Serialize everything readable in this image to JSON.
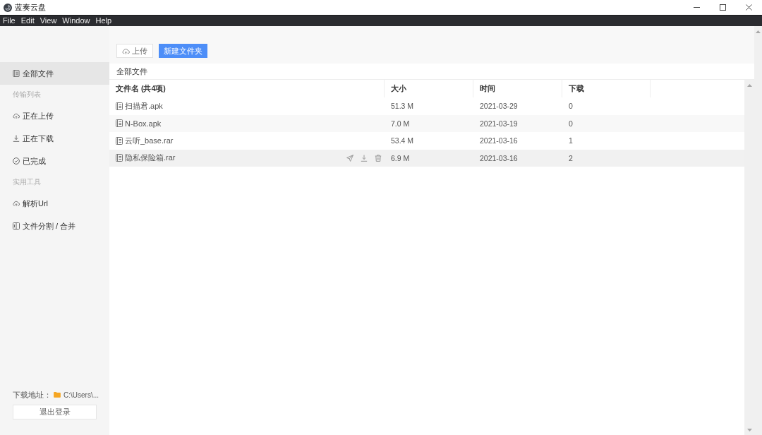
{
  "window": {
    "title": "蓝奏云盘"
  },
  "menu": [
    "File",
    "Edit",
    "View",
    "Window",
    "Help"
  ],
  "sidebar": {
    "groups": [
      {
        "items": [
          {
            "label": "全部文件",
            "selected": true
          }
        ]
      },
      {
        "heading": "传输列表",
        "items": [
          {
            "label": "正在上传",
            "selected": false
          },
          {
            "label": "正在下载",
            "selected": false
          },
          {
            "label": "已完成",
            "selected": false
          }
        ]
      },
      {
        "heading": "实用工具",
        "items": [
          {
            "label": "解析Url",
            "selected": false
          },
          {
            "label": "文件分割 / 合并",
            "selected": false
          }
        ]
      }
    ],
    "download_path": {
      "label": "下载地址：",
      "value": "C:\\Users\\..."
    },
    "logout_button": "退出登录"
  },
  "toolbar": {
    "upload_button": "上传",
    "new_folder_button": "新建文件夹"
  },
  "breadcrumb": "全部文件",
  "table": {
    "columns": [
      "文件名 (共4项)",
      "大小",
      "时间",
      "下载"
    ],
    "rows": [
      {
        "name": "扫描君.apk",
        "size": "51.3 M",
        "time": "2021-03-29",
        "downloads": "0",
        "hovered": false
      },
      {
        "name": "N-Box.apk",
        "size": "7.0 M",
        "time": "2021-03-19",
        "downloads": "0",
        "hovered": false
      },
      {
        "name": "云听_base.rar",
        "size": "53.4 M",
        "time": "2021-03-16",
        "downloads": "1",
        "hovered": false
      },
      {
        "name": "隐私保险箱.rar",
        "size": "6.9 M",
        "time": "2021-03-16",
        "downloads": "2",
        "hovered": true
      }
    ]
  }
}
